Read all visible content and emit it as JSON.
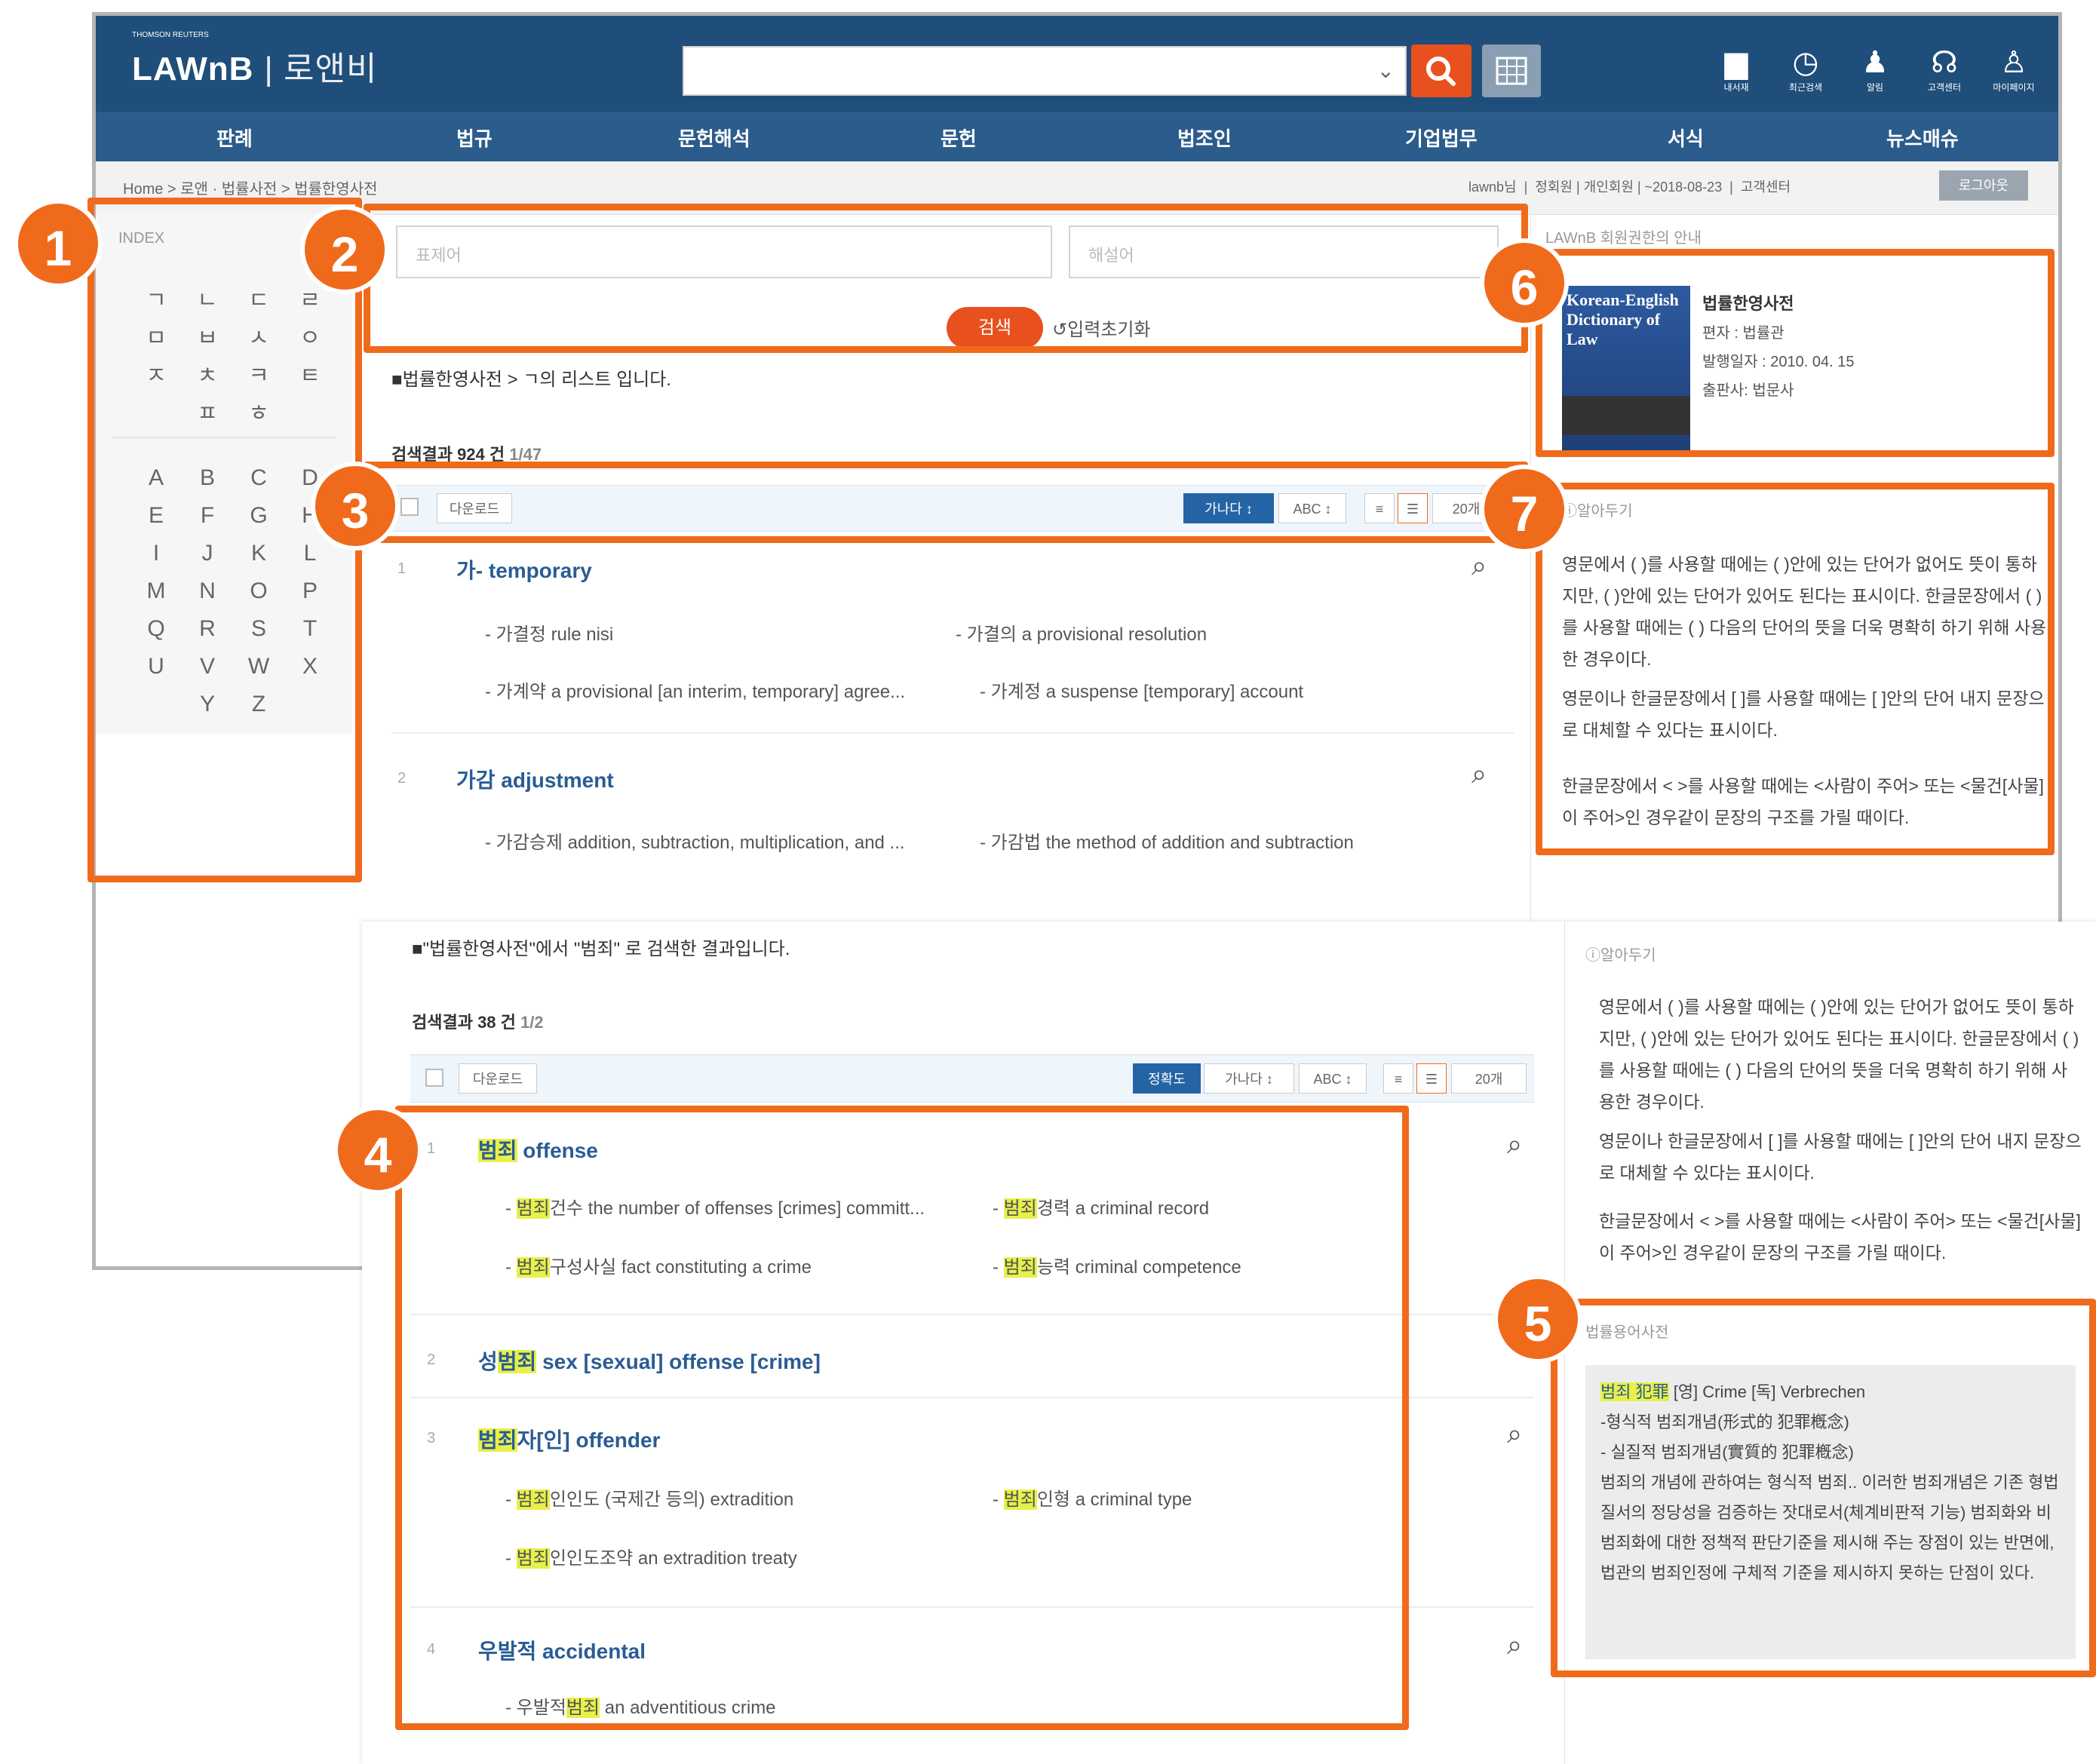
{
  "header": {
    "brand_tiny": "THOMSON REUTERS",
    "brand": "LAWnB",
    "brand_sub": "| 로앤비",
    "icons": [
      {
        "name": "folder-icon",
        "label": "내서재",
        "glyph": "▆"
      },
      {
        "name": "history-icon",
        "label": "최근검색",
        "glyph": "◷"
      },
      {
        "name": "bell-icon",
        "label": "알림",
        "glyph": "♟"
      },
      {
        "name": "headset-icon",
        "label": "고객센터",
        "glyph": "☊"
      },
      {
        "name": "user-icon",
        "label": "마이페이지",
        "glyph": "♙"
      }
    ]
  },
  "nav": [
    "판례",
    "법규",
    "문헌해석",
    "문헌",
    "법조인",
    "기업법무",
    "서식",
    "뉴스매슈"
  ],
  "breadcrumb": "Home > 로앤 · 법률사전 > 법률한영사전",
  "top_right": {
    "user": "lawnb님",
    "info": "정회원 | 개인회원 | ~2018-08-23",
    "center": "고객센터",
    "logout": "로그아웃"
  },
  "index": {
    "title": "INDEX",
    "korean": [
      "ㄱ",
      "ㄴ",
      "ㄷ",
      "ㄹ",
      "ㅁ",
      "ㅂ",
      "ㅅ",
      "ㅇ",
      "ㅈ",
      "ㅊ",
      "ㅋ",
      "ㅌ",
      "ㅍ",
      "ㅎ"
    ],
    "latin": [
      "A",
      "B",
      "C",
      "D",
      "E",
      "F",
      "G",
      "H",
      "I",
      "J",
      "K",
      "L",
      "M",
      "N",
      "O",
      "P",
      "Q",
      "R",
      "S",
      "T",
      "U",
      "V",
      "W",
      "X",
      "Y",
      "Z"
    ]
  },
  "form": {
    "field1": "표제어",
    "field2": "해설어",
    "search": "검색",
    "reset": "입력초기화"
  },
  "list_heading": "■법률한영사전 > ㄱ의 리스트 입니다.",
  "result_count": "검색결과 924 건",
  "result_pages": "1/47",
  "toolbar": {
    "download": "다운로드",
    "sort_ga": "가나다 ↕",
    "sort_abc": "ABC ↕",
    "perpage": "20개",
    "sort_accuracy": "정확도"
  },
  "entries_top": [
    {
      "num": "1",
      "term": "가- temporary",
      "subs": [
        "- 가결정 rule nisi",
        "- 가결의 a provisional resolution",
        "- 가계약 a provisional [an interim, temporary] agree...",
        "- 가계정 a suspense [temporary] account"
      ]
    },
    {
      "num": "2",
      "term": "가감 adjustment",
      "subs": [
        "- 가감승제 addition, subtraction, multiplication, and ...",
        "- 가감법 the method of addition and subtraction"
      ]
    }
  ],
  "book": {
    "cover_title": "Korean-English Dictionary of Law",
    "title": "법률한영사전",
    "author": "편자 : 법률관",
    "date": "발행일자 : 2010. 04. 15",
    "publisher": "출판사: 법문사"
  },
  "notice_title": "LAWnB 회원권한의 안내",
  "memo_title": "ⓘ알아두기",
  "memo": [
    "영문에서 ( )를 사용할 때에는 ( )안에 있는 단어가 없어도 뜻이 통하지만, ( )안에 있는 단어가 있어도 된다는 표시이다. 한글문장에서 ( )를 사용할 때에는 ( ) 다음의 단어의 뜻을 더욱 명확히 하기 위해 사용한 경우이다.",
    "영문이나 한글문장에서 [ ]를 사용할 때에는 [ ]안의 단어 내지 문장으로 대체할 수 있다는 표시이다.",
    "한글문장에서 < >를 사용할 때에는 <사람이 주어> 또는 <물건[사물]이 주어>인 경우같이 문장의 구조를 가릴 때이다."
  ],
  "search2": {
    "heading": "■\"법률한영사전\"에서 \"범죄\" 로 검색한 결과입니다.",
    "count": "검색결과 38 건",
    "pages": "1/2"
  },
  "entries_search": [
    {
      "num": "1",
      "pre": "",
      "hl": "범죄",
      "post": " offense",
      "subs": [
        {
          "pre": "- ",
          "hl": "범죄",
          "post": "건수 the number of offenses [crimes] committ..."
        },
        {
          "pre": "- ",
          "hl": "범죄",
          "post": "경력 a criminal record"
        },
        {
          "pre": "- ",
          "hl": "범죄",
          "post": "구성사실 fact constituting a crime"
        },
        {
          "pre": "- ",
          "hl": "범죄",
          "post": "능력 criminal competence"
        }
      ]
    },
    {
      "num": "2",
      "pre": "성",
      "hl": "범죄",
      "post": " sex [sexual] offense [crime]",
      "subs": []
    },
    {
      "num": "3",
      "pre": "",
      "hl": "범죄",
      "post": "자[인] offender",
      "subs": [
        {
          "pre": "- ",
          "hl": "범죄",
          "post": "인인도 (국제간 등의) extradition"
        },
        {
          "pre": "- ",
          "hl": "범죄",
          "post": "인형 a criminal type"
        },
        {
          "pre": "- ",
          "hl": "범죄",
          "post": "인인도조약 an extradition treaty"
        }
      ]
    },
    {
      "num": "4",
      "pre": "우발적",
      "hl": "",
      "post": " accidental",
      "subs": [
        {
          "pre": "- 우발적",
          "hl": "범죄",
          "post": " an adventitious crime"
        }
      ]
    }
  ],
  "legal_dict": {
    "title": "법률용어사전",
    "headword": "범죄 犯罪",
    "head_rest": " [영] Crime [독] Verbrechen",
    "line1": "-형식적 범죄개념(形式的 犯罪槪念)",
    "line2": "- 실질적 범죄개념(實質的 犯罪槪念)",
    "body": "범죄의 개념에 관하여는 형식적 범죄.. 이러한 범죄개념은 기존 형법질서의 정당성을 검증하는 잣대로서(체계비판적 기능) 범죄화와 비범죄화에 대한 정책적 판단기준을 제시해 주는 장점이 있는 반면에, 법관의 범죄인정에 구체적 기준을 제시하지 못하는 단점이 있다."
  },
  "badges": [
    "1",
    "2",
    "3",
    "4",
    "5",
    "6",
    "7"
  ],
  "colors": {
    "header": "#1f4e7a",
    "nav": "#2b5c8c",
    "accent": "#f06a1c",
    "search_btn": "#e8501e",
    "link": "#2a5c94",
    "highlight": "#e8f04a"
  }
}
